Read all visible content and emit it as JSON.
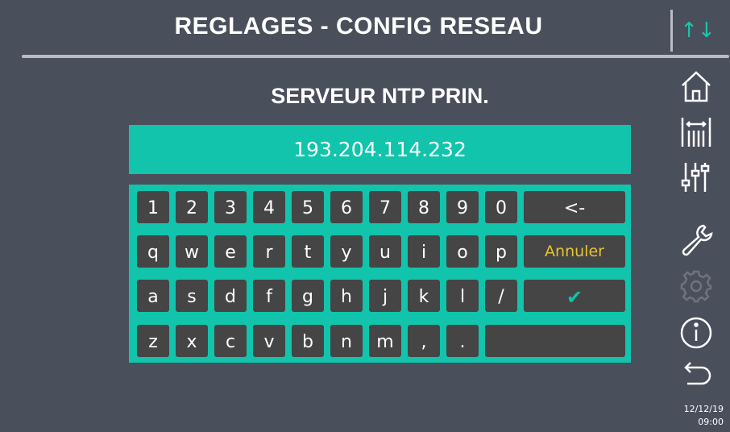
{
  "header": {
    "title": "REGLAGES - CONFIG RESEAU",
    "sync_icon_glyph": "↑↓"
  },
  "field": {
    "label": "SERVEUR NTP PRIN.",
    "value": "193.204.114.232"
  },
  "keyboard": {
    "rows": [
      [
        "1",
        "2",
        "3",
        "4",
        "5",
        "6",
        "7",
        "8",
        "9",
        "0"
      ],
      [
        "q",
        "w",
        "e",
        "r",
        "t",
        "y",
        "u",
        "i",
        "o",
        "p"
      ],
      [
        "a",
        "s",
        "d",
        "f",
        "g",
        "h",
        "j",
        "k",
        "l",
        "/"
      ],
      [
        "z",
        "x",
        "c",
        "v",
        "b",
        "n",
        "m",
        ",",
        "."
      ]
    ],
    "backspace_label": "<-",
    "cancel_label": "Annuler",
    "confirm_label": "✔",
    "space_label": ""
  },
  "sidebar": {
    "icons": [
      "home-icon",
      "calibration-icon",
      "sliders-icon",
      "wrench-icon",
      "gear-icon",
      "info-icon",
      "back-icon"
    ]
  },
  "status": {
    "date": "12/12/19",
    "time": "09:00"
  },
  "colors": {
    "background": "#4a4f5c",
    "accent": "#11c4ab",
    "key": "#454545",
    "cancel_text": "#e8c330"
  }
}
